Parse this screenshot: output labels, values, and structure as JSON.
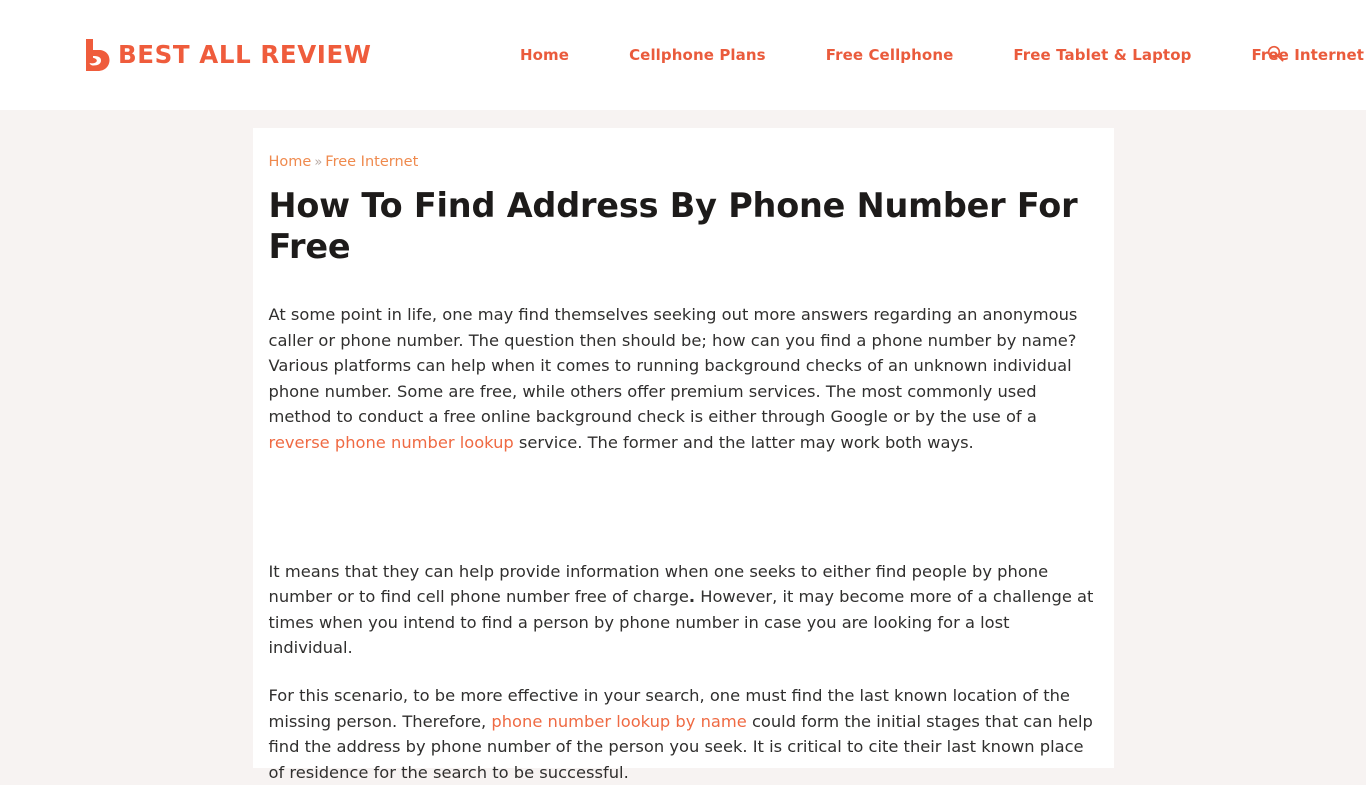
{
  "theme": {
    "brand_orange": "#ea5b3c",
    "logo_orange": "#ef5c3c",
    "link_orange": "#ef6a43",
    "breadcrumb_orange": "#ef8a4e",
    "page_bg": "#f7f3f2",
    "card_bg": "#ffffff",
    "body_text": "#302f2e",
    "title_text": "#1d1b1a"
  },
  "header": {
    "logo": {
      "icon": "b-mark-logo-icon",
      "text": "BEST ALL REVIEW"
    },
    "nav": [
      {
        "label": "Home"
      },
      {
        "label": "Cellphone Plans"
      },
      {
        "label": "Free Cellphone"
      },
      {
        "label": "Free Tablet & Laptop"
      },
      {
        "label": "Free Internet"
      }
    ],
    "search": {
      "icon": "search-icon",
      "label": "Search"
    }
  },
  "breadcrumb": {
    "home": "Home",
    "separator": "»",
    "current": "Free Internet"
  },
  "article": {
    "title": "How To Find Address By Phone Number For Free",
    "p1_part1": "At some point in life, one may find themselves seeking out more answers regarding an anonymous caller or phone number. The question then should be; how can you find a phone number by name? Various platforms can help when it comes to running background checks of an unknown individual phone number. Some are free, while others offer premium services. The most commonly used method to conduct a free online background check is either through Google or by the use of a ",
    "p1_link": "reverse phone number lookup",
    "p1_part2": " service. The former and the latter may work both ways.",
    "p2_part1": "It means that they can help provide information when one seeks to either find people by phone number or to find cell phone number free of charge",
    "p2_bold": ".",
    "p2_part2": " However, it may become more of a challenge at times when you intend to find a person by phone number in case you are looking for a lost individual.",
    "p3_part1": "For this scenario, to be more effective in your search, one must find the last known location of the missing person. Therefore, ",
    "p3_link": "phone number lookup by name",
    "p3_part2": " could form the initial stages that can help find the address by phone number of the person you seek. It is critical to cite their last known place of residence for the search to be successful."
  }
}
